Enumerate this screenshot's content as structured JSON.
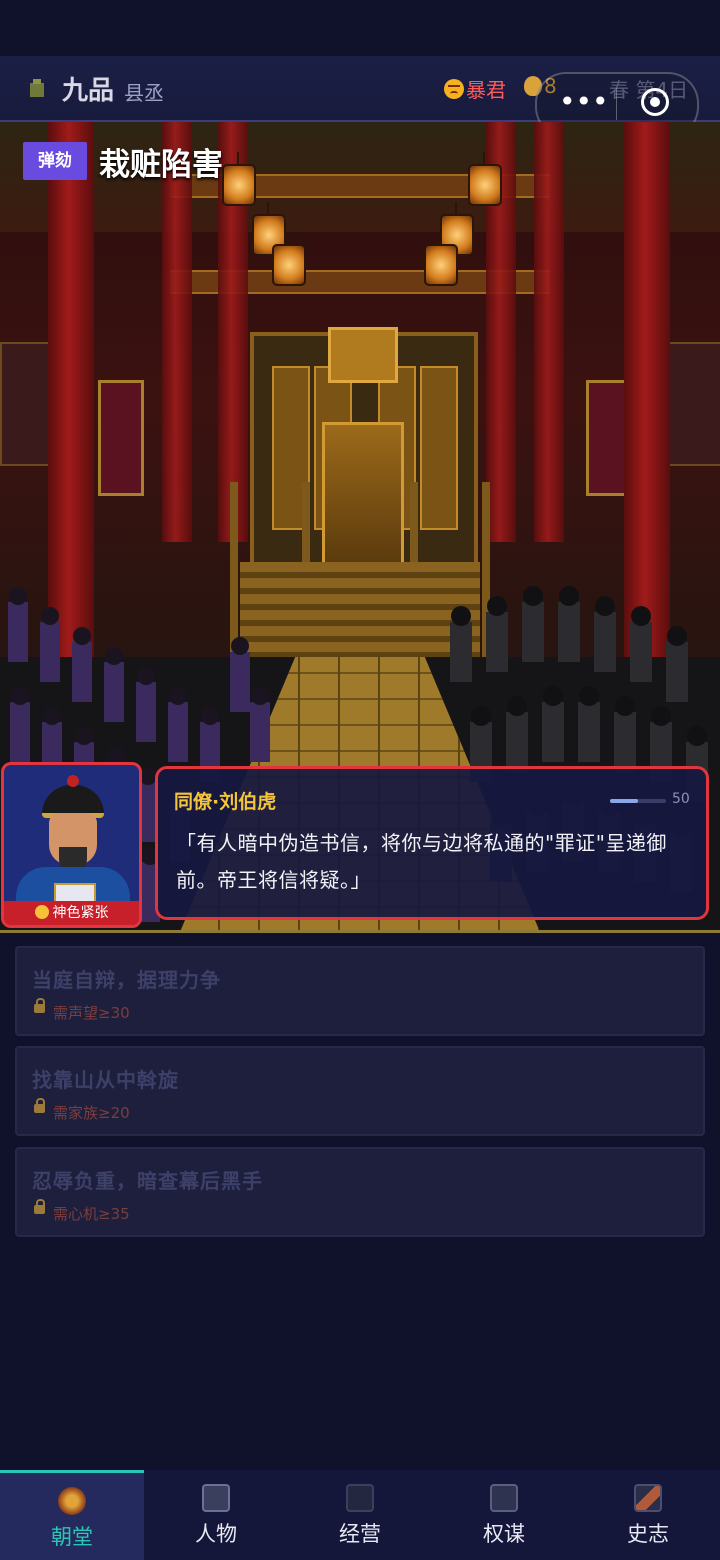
{
  "header": {
    "rank": "九品",
    "title": "县丞",
    "emperor_mood": "暴君",
    "money": "8",
    "date": "春 第4日",
    "colors": {
      "mood": "#ff5a5a",
      "money": "#f2b13a"
    }
  },
  "event": {
    "type_chip": "弹劾",
    "title": "栽赃陷害"
  },
  "character": {
    "name": "同僚·刘伯虎",
    "mood_tag": "神色紧张",
    "meter_value": 50,
    "meter_fraction": 0.5,
    "speech": "「有人暗中伪造书信，将你与边将私通的\"罪证\"呈递御前。帝王将信将疑。」"
  },
  "options": [
    {
      "text": "当庭自辩，据理力争",
      "requirement": "需声望≥30",
      "locked": true
    },
    {
      "text": "找靠山从中斡旋",
      "requirement": "需家族≥20",
      "locked": true
    },
    {
      "text": "忍辱负重，暗查幕后黑手",
      "requirement": "需心机≥35",
      "locked": true
    }
  ],
  "tabs": [
    {
      "label": "朝堂",
      "icon": "court-icon",
      "active": true
    },
    {
      "label": "人物",
      "icon": "handshake-icon",
      "active": false
    },
    {
      "label": "经营",
      "icon": "flag-icon",
      "active": false
    },
    {
      "label": "权谋",
      "icon": "crossed-swords-icon",
      "active": false
    },
    {
      "label": "史志",
      "icon": "scroll-icon",
      "active": false
    }
  ],
  "accent": "#29c6b5"
}
